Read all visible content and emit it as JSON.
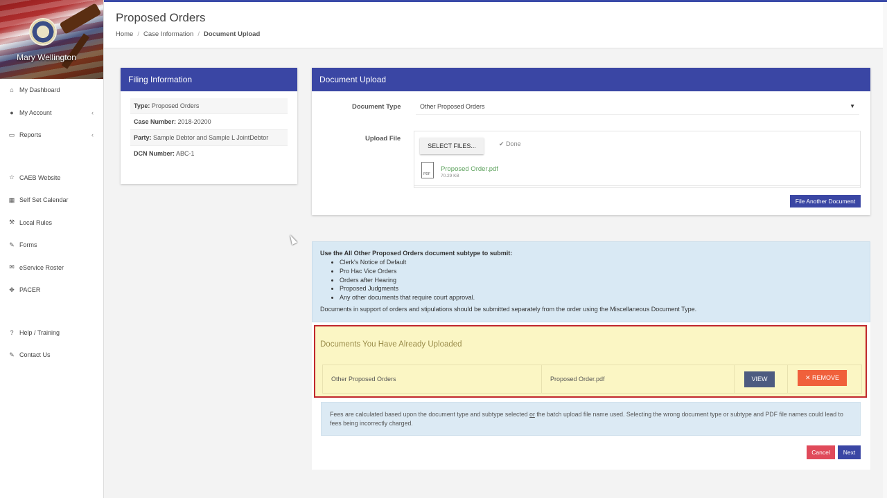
{
  "user": {
    "name": "Mary Wellington"
  },
  "sidebar": {
    "items": [
      {
        "label": "My Dashboard",
        "icon": "home-icon"
      },
      {
        "label": "My Account",
        "icon": "user-icon",
        "caret": "‹"
      },
      {
        "label": "Reports",
        "icon": "keyboard-icon",
        "caret": "‹"
      }
    ],
    "links": [
      {
        "label": "CAEB Website",
        "icon": "star-icon"
      },
      {
        "label": "Self Set Calendar",
        "icon": "calendar-icon"
      },
      {
        "label": "Local Rules",
        "icon": "gavel-icon"
      },
      {
        "label": "Forms",
        "icon": "edit-icon"
      },
      {
        "label": "eService Roster",
        "icon": "envelope-icon"
      },
      {
        "label": "PACER",
        "icon": "gear-icon"
      }
    ],
    "help": [
      {
        "label": "Help / Training",
        "icon": "question-icon"
      },
      {
        "label": "Contact Us",
        "icon": "edit-icon"
      }
    ]
  },
  "header": {
    "title": "Proposed Orders",
    "breadcrumb": {
      "home": "Home",
      "case": "Case Information",
      "current": "Document Upload"
    }
  },
  "filing": {
    "title": "Filing Information",
    "rows": [
      {
        "label": "Type:",
        "value": "Proposed Orders"
      },
      {
        "label": "Case Number:",
        "value": "2018-20200"
      },
      {
        "label": "Party:",
        "value": "Sample Debtor and Sample L JointDebtor"
      },
      {
        "label": "DCN Number:",
        "value": "ABC-1"
      }
    ]
  },
  "upload": {
    "title": "Document Upload",
    "doc_type_label": "Document Type",
    "doc_type_value": "Other Proposed Orders",
    "upload_label": "Upload File",
    "select_files": "SELECT FILES...",
    "done": "Done",
    "file_name": "Proposed Order.pdf",
    "file_size": "70.29 KB",
    "file_another": "File Another Document"
  },
  "info": {
    "title": "Use the All Other Proposed Orders document subtype to submit:",
    "bullets": [
      "Clerk's Notice of Default",
      "Pro Hac Vice Orders",
      "Orders after Hearing",
      "Proposed Judgments",
      "Any other documents that require court approval."
    ],
    "footer": "Documents in support of orders and stipulations should be submitted separately from the order using the Miscellaneous Document Type."
  },
  "already": {
    "title": "Documents You Have Already Uploaded",
    "row": {
      "type": "Other Proposed Orders",
      "file": "Proposed Order.pdf",
      "view": "VIEW",
      "remove": "REMOVE"
    }
  },
  "fees": {
    "part1": "Fees are calculated based upon the document type and subtype selected ",
    "or": "or",
    "part2": " the batch upload file name used. Selecting the wrong document type or subtype and PDF file names could lead to fees being incorrectly charged."
  },
  "actions": {
    "cancel": "Cancel",
    "next": "Next"
  },
  "colors": {
    "primary": "#3a46a4",
    "danger": "#f0603b",
    "highlight": "#fbf6c4",
    "info": "#d9e9f4"
  }
}
